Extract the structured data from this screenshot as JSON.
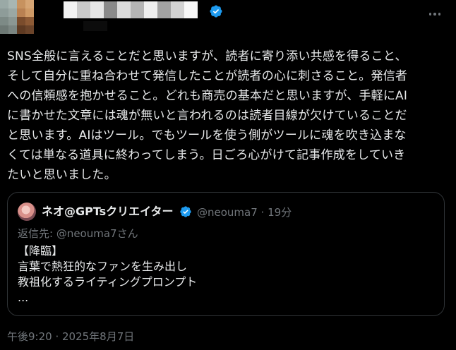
{
  "post": {
    "verified_color": "#1d9bf0",
    "more_icon": "more-horizontal-icon",
    "text": "SNS全般に言えることだと思いますが、読者に寄り添い共感を得ること、\nそして自分に重ね合わせて発信したことが読者の心に刺さること。発信者\nへの信頼感を抱かせること。どれも商売の基本だと思いますが、手軽にAI\nに書かせた文章には魂が無いと言われるのは読者目線が欠けていることだ\nと思います。AIはツール。でもツールを使う側がツールに魂を吹き込まな\nくては単なる道具に終わってしまう。日ごろ心がけて記事作成をしていき\nたいと思いました。",
    "timestamp": "午後9:20 · 2025年8月7日"
  },
  "quote": {
    "author_name": "ネオ@GPTsクリエイター",
    "handle_time": "@neouma7 · 19分",
    "reply_to": "返信先: @neouma7さん",
    "text": "【降臨】\n言葉で熱狂的なファンを生み出し\n教祖化するライティングプロンプト\n..."
  }
}
